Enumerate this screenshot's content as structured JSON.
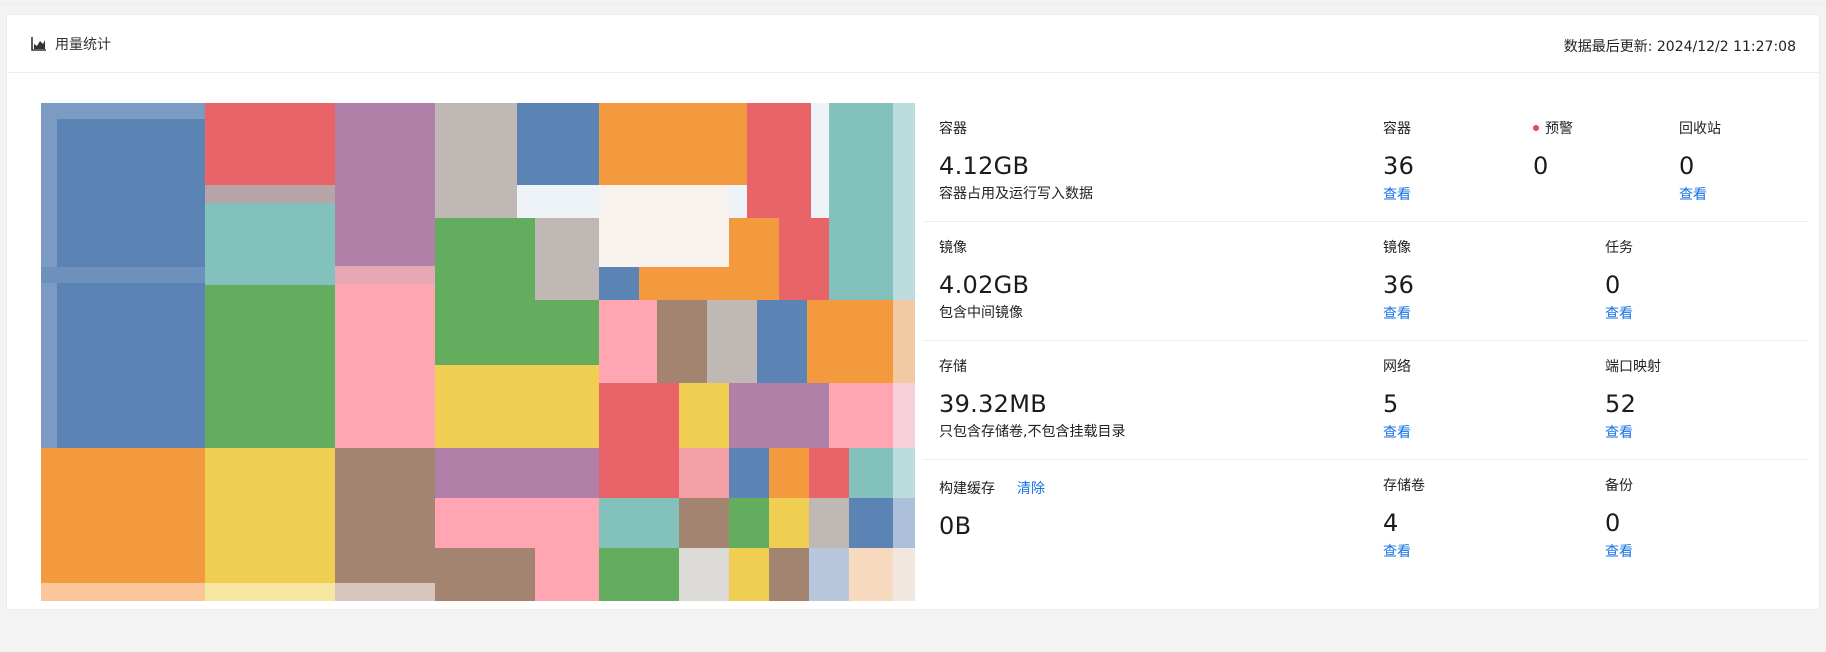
{
  "header": {
    "title": "用量统计",
    "update_label": "数据最后更新: 2024/12/2 11:27:08"
  },
  "colors": {
    "link": "#1473e6",
    "warning_dot": "#e5484d",
    "treemap_palette": [
      "#5b83b3",
      "#e96468",
      "#b080a8",
      "#c0b8b4",
      "#f49a3e",
      "#82c1bc",
      "#64ad5e",
      "#ffa6b2",
      "#efce52",
      "#a28470"
    ]
  },
  "stats": {
    "containers": {
      "label": "容器",
      "value": "4.12GB",
      "desc": "容器占用及运行写入数据",
      "count_label": "容器",
      "count": "36",
      "count_link": "查看",
      "warn_label": "预警",
      "warn_count": "0",
      "recycle_label": "回收站",
      "recycle_count": "0",
      "recycle_link": "查看"
    },
    "images": {
      "label": "镜像",
      "value": "4.02GB",
      "desc": "包含中间镜像",
      "count_label": "镜像",
      "count": "36",
      "count_link": "查看",
      "task_label": "任务",
      "task_count": "0",
      "task_link": "查看"
    },
    "storage": {
      "label": "存储",
      "value": "39.32MB",
      "desc": "只包含存储卷,不包含挂载目录",
      "network_label": "网络",
      "network_count": "5",
      "network_link": "查看",
      "port_label": "端口映射",
      "port_count": "52",
      "port_link": "查看"
    },
    "build_cache": {
      "label": "构建缓存",
      "clear_label": "清除",
      "value": "0B",
      "volume_label": "存储卷",
      "volume_count": "4",
      "volume_link": "查看",
      "backup_label": "备份",
      "backup_count": "0",
      "backup_link": "查看"
    }
  }
}
